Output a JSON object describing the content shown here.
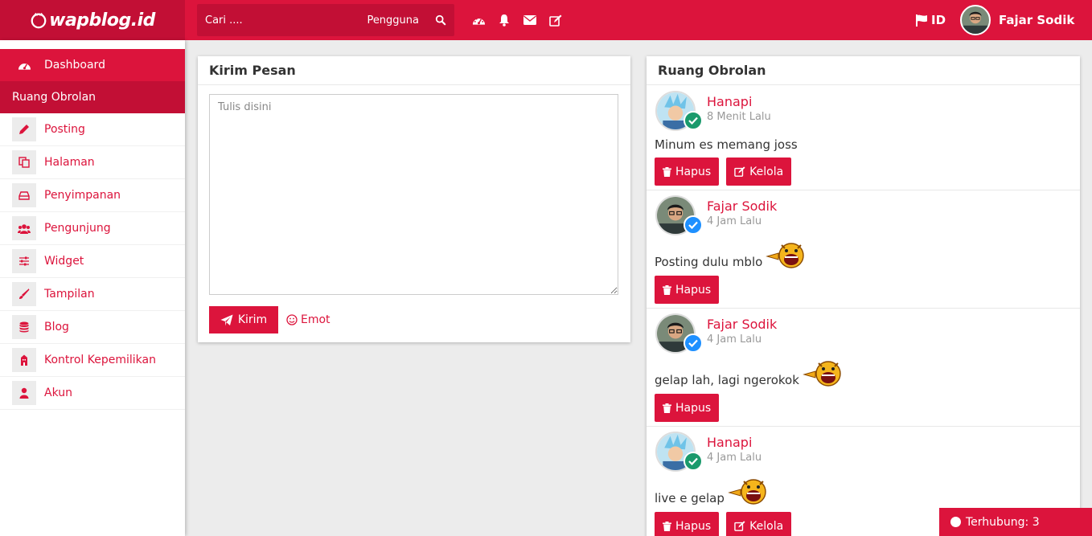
{
  "brand": {
    "logo_text": "wapblog.id"
  },
  "search": {
    "placeholder": "Cari ....",
    "type_label": "Pengguna"
  },
  "topbar": {
    "icons": [
      "dashboard-icon",
      "bell-icon",
      "envelope-icon",
      "edit-icon"
    ],
    "language": "ID",
    "user_name": "Fajar Sodik"
  },
  "sidebar": {
    "active": {
      "label": "Dashboard",
      "icon": "dashboard-icon"
    },
    "section_header": "Ruang Obrolan",
    "items": [
      {
        "label": "Posting",
        "icon": "pencil-icon"
      },
      {
        "label": "Halaman",
        "icon": "copy-icon"
      },
      {
        "label": "Penyimpanan",
        "icon": "drive-icon"
      },
      {
        "label": "Pengunjung",
        "icon": "users-icon"
      },
      {
        "label": "Widget",
        "icon": "sliders-icon"
      },
      {
        "label": "Tampilan",
        "icon": "brush-icon"
      },
      {
        "label": "Blog",
        "icon": "database-icon"
      },
      {
        "label": "Kontrol Kepemilikan",
        "icon": "building-icon"
      },
      {
        "label": "Akun",
        "icon": "user-icon"
      }
    ]
  },
  "compose": {
    "title": "Kirim Pesan",
    "placeholder": "Tulis disini",
    "send_label": "Kirim",
    "emot_label": "Emot"
  },
  "chat": {
    "title": "Ruang Obrolan",
    "messages": [
      {
        "author": "Hanapi",
        "time": "8 Menit Lalu",
        "text": "Minum es memang joss",
        "badge": "check-green",
        "actions": [
          "Hapus",
          "Kelola"
        ],
        "emoticon": false
      },
      {
        "author": "Fajar Sodik",
        "time": "4 Jam Lalu",
        "text": "Posting dulu mblo",
        "badge": "check-blue",
        "actions": [
          "Hapus"
        ],
        "emoticon": true
      },
      {
        "author": "Fajar Sodik",
        "time": "4 Jam Lalu",
        "text": "gelap lah, lagi ngerokok",
        "badge": "check-blue",
        "actions": [
          "Hapus"
        ],
        "emoticon": true
      },
      {
        "author": "Hanapi",
        "time": "4 Jam Lalu",
        "text": "live e gelap",
        "badge": "check-green",
        "actions": [
          "Hapus",
          "Kelola"
        ],
        "emoticon": true
      }
    ]
  },
  "status": {
    "label": "Terhubung: 3"
  },
  "colors": {
    "accent": "#dc143c",
    "accent_dark": "#c20f35",
    "badge_green": "#1a9a6c",
    "badge_blue": "#1e90ff"
  }
}
